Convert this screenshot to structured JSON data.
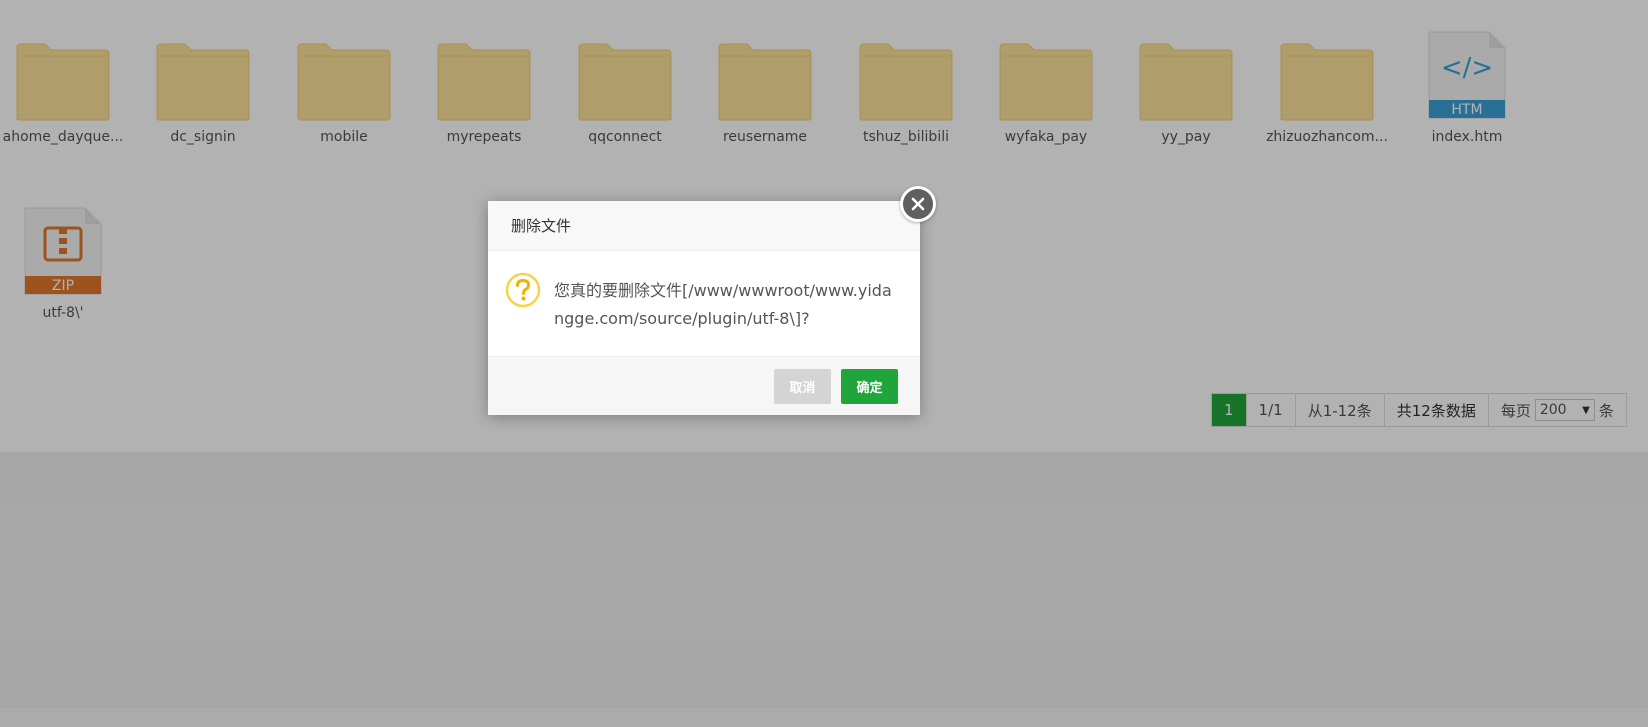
{
  "files": [
    {
      "name": "ahome_dayque...",
      "type": "folder"
    },
    {
      "name": "dc_signin",
      "type": "folder"
    },
    {
      "name": "mobile",
      "type": "folder"
    },
    {
      "name": "myrepeats",
      "type": "folder"
    },
    {
      "name": "qqconnect",
      "type": "folder"
    },
    {
      "name": "reusername",
      "type": "folder"
    },
    {
      "name": "tshuz_bilibili",
      "type": "folder"
    },
    {
      "name": "wyfaka_pay",
      "type": "folder"
    },
    {
      "name": "yy_pay",
      "type": "folder"
    },
    {
      "name": "zhizuozhancom...",
      "type": "folder"
    },
    {
      "name": "index.htm",
      "type": "htm",
      "badge": "HTM",
      "glyph": "</>"
    },
    {
      "name": "utf-8\\'",
      "type": "zip",
      "badge": "ZIP"
    }
  ],
  "pager": {
    "current": "1",
    "pages": "1/1",
    "range": "从1-12条",
    "total": "共12条数据",
    "per_page_label": "每页",
    "per_page_value": "200",
    "per_page_unit": "条"
  },
  "dialog": {
    "title": "删除文件",
    "message": "您真的要删除文件[/www/wwwroot/www.yidangge.com/source/plugin/utf-8\\]?",
    "cancel_label": "取消",
    "ok_label": "确定"
  },
  "colors": {
    "folder": "#fbe29b",
    "folder_tab": "#f7d87f",
    "accent_green": "#20a53a",
    "htm_blue": "#3a9fd6",
    "zip_orange": "#e0772a"
  },
  "icons": {
    "folder": "folder-icon",
    "htm": "htm-file-icon",
    "zip": "zip-file-icon",
    "question": "question-icon",
    "close": "close-icon",
    "dropdown": "chevron-down-icon"
  }
}
